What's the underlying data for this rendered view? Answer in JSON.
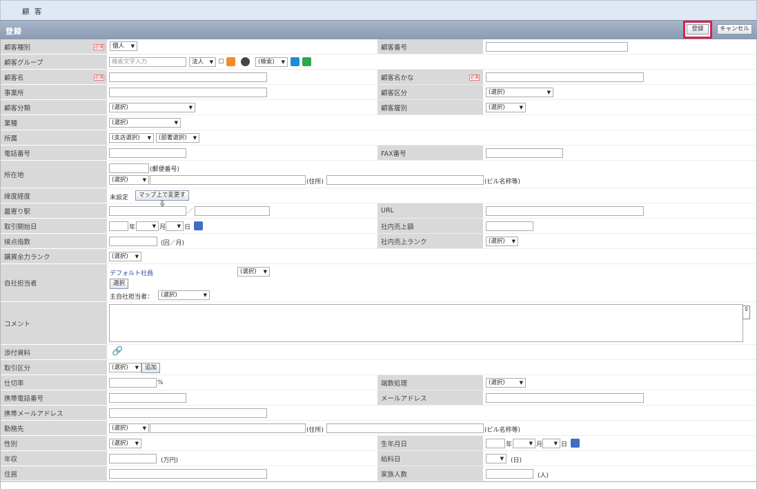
{
  "header": {
    "title": "顧 客",
    "section": "登録",
    "register_btn": "登録",
    "cancel_btn": "キャンセル"
  },
  "labels": {
    "customer_type": "顧客種別",
    "customer_no": "顧客番号",
    "group": "顧客グループ",
    "name": "顧客名",
    "name_kana": "顧客名かな",
    "office": "事業所",
    "division": "顧客区分",
    "category": "顧客分類",
    "tier": "顧客層別",
    "industry": "業種",
    "affiliation": "所属",
    "phone": "電話番号",
    "fax": "FAX番号",
    "address": "所在地",
    "latlng": "緯度経度",
    "station": "最寄り駅",
    "url": "URL",
    "start_date": "取引開始日",
    "sales": "社内売上額",
    "contact_count": "接点指数",
    "sales_rank": "社内売上ランク",
    "purchase_rank": "購買余力ランク",
    "staff": "自社担当者",
    "comment": "コメント",
    "attachment": "添付資料",
    "trade_type": "取引区分",
    "cost_rate": "仕切率",
    "rounding": "端数処理",
    "mobile": "携帯電話番号",
    "email": "メールアドレス",
    "mobile_mail": "携帯メールアドレス",
    "workplace": "勤務先",
    "gender": "性別",
    "birthday": "生年月日",
    "income": "年収",
    "payday": "給料日",
    "residence": "住居",
    "family": "家族人数"
  },
  "required": "必須",
  "values": {
    "customer_type": "個人",
    "search_placeholder": "検索文字入力",
    "corp": "法人",
    "search_sel": "(検索)",
    "select": "(選択)",
    "branch": "(支店選択)",
    "dept": "(部署選択)",
    "postal_label": "(郵便番号)",
    "addr_label": "(住所)",
    "bldg_label": "(ビル名称等)",
    "unset": "未設定",
    "map_btn": "マップ上で変更する",
    "slash": "／",
    "year": "年",
    "month": "月",
    "day": "日",
    "times_month": "(回／月)",
    "default_staff": "デフォルト社員",
    "select_btn": "選択",
    "main_staff": "主自社担当者：",
    "add_btn": "追加",
    "percent": "%",
    "man_yen": "(万円)",
    "day_paren": "(日)",
    "person": "(人)"
  }
}
